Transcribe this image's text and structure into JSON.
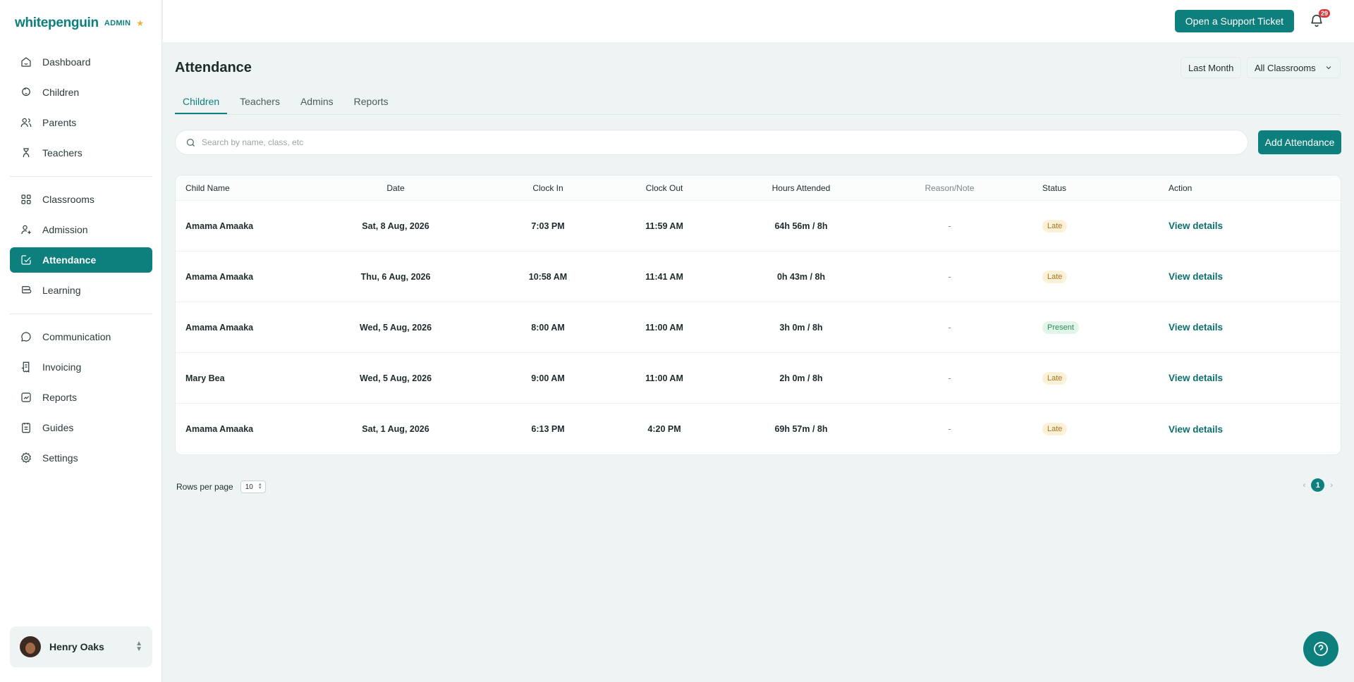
{
  "brand": {
    "name": "whitepenguin",
    "badge": "ADMIN"
  },
  "sidebar": {
    "groups": [
      [
        {
          "label": "Dashboard",
          "icon": "home-icon"
        },
        {
          "label": "Children",
          "icon": "child-icon"
        },
        {
          "label": "Parents",
          "icon": "users-icon"
        },
        {
          "label": "Teachers",
          "icon": "teacher-icon"
        }
      ],
      [
        {
          "label": "Classrooms",
          "icon": "grid-icon"
        },
        {
          "label": "Admission",
          "icon": "user-add-icon"
        },
        {
          "label": "Attendance",
          "icon": "check-square-icon"
        },
        {
          "label": "Learning",
          "icon": "book-icon"
        }
      ],
      [
        {
          "label": "Communication",
          "icon": "chat-icon"
        },
        {
          "label": "Invoicing",
          "icon": "receipt-icon"
        },
        {
          "label": "Reports",
          "icon": "chart-icon"
        },
        {
          "label": "Guides",
          "icon": "guide-icon"
        },
        {
          "label": "Settings",
          "icon": "gear-icon"
        }
      ]
    ],
    "active": "Attendance",
    "user": {
      "name": "Henry Oaks"
    }
  },
  "header": {
    "support_label": "Open a Support Ticket",
    "notification_count": "29"
  },
  "page": {
    "title": "Attendance",
    "filters": {
      "period": "Last Month",
      "classroom": "All Classrooms"
    },
    "tabs": [
      "Children",
      "Teachers",
      "Admins",
      "Reports"
    ],
    "active_tab": "Children",
    "search_placeholder": "Search by name, class, etc",
    "add_label": "Add Attendance"
  },
  "table": {
    "columns": [
      "Child Name",
      "Date",
      "Clock In",
      "Clock Out",
      "Hours Attended",
      "Reason/Note",
      "Status",
      "Action"
    ],
    "rows": [
      {
        "name": "Amama Amaaka",
        "date": "Sat, 8 Aug, 2026",
        "clock_in": "7:03 PM",
        "clock_out": "11:59 AM",
        "hours": "64h 56m / 8h",
        "reason": "-",
        "status": "Late",
        "action": "View details"
      },
      {
        "name": "Amama Amaaka",
        "date": "Thu, 6 Aug, 2026",
        "clock_in": "10:58 AM",
        "clock_out": "11:41 AM",
        "hours": "0h 43m / 8h",
        "reason": "-",
        "status": "Late",
        "action": "View details"
      },
      {
        "name": "Amama Amaaka",
        "date": "Wed, 5 Aug, 2026",
        "clock_in": "8:00 AM",
        "clock_out": "11:00 AM",
        "hours": "3h 0m / 8h",
        "reason": "-",
        "status": "Present",
        "action": "View details"
      },
      {
        "name": "Mary Bea",
        "date": "Wed, 5 Aug, 2026",
        "clock_in": "9:00 AM",
        "clock_out": "11:00 AM",
        "hours": "2h 0m / 8h",
        "reason": "-",
        "status": "Late",
        "action": "View details"
      },
      {
        "name": "Amama Amaaka",
        "date": "Sat, 1 Aug, 2026",
        "clock_in": "6:13 PM",
        "clock_out": "4:20 PM",
        "hours": "69h 57m / 8h",
        "reason": "-",
        "status": "Late",
        "action": "View details"
      }
    ]
  },
  "pagination": {
    "rows_label": "Rows per page",
    "rows_value": "10",
    "current_page": "1"
  },
  "colors": {
    "brand": "#0d7f7c",
    "late_bg": "#fbf1d8",
    "present_bg": "#e2f5ea"
  }
}
